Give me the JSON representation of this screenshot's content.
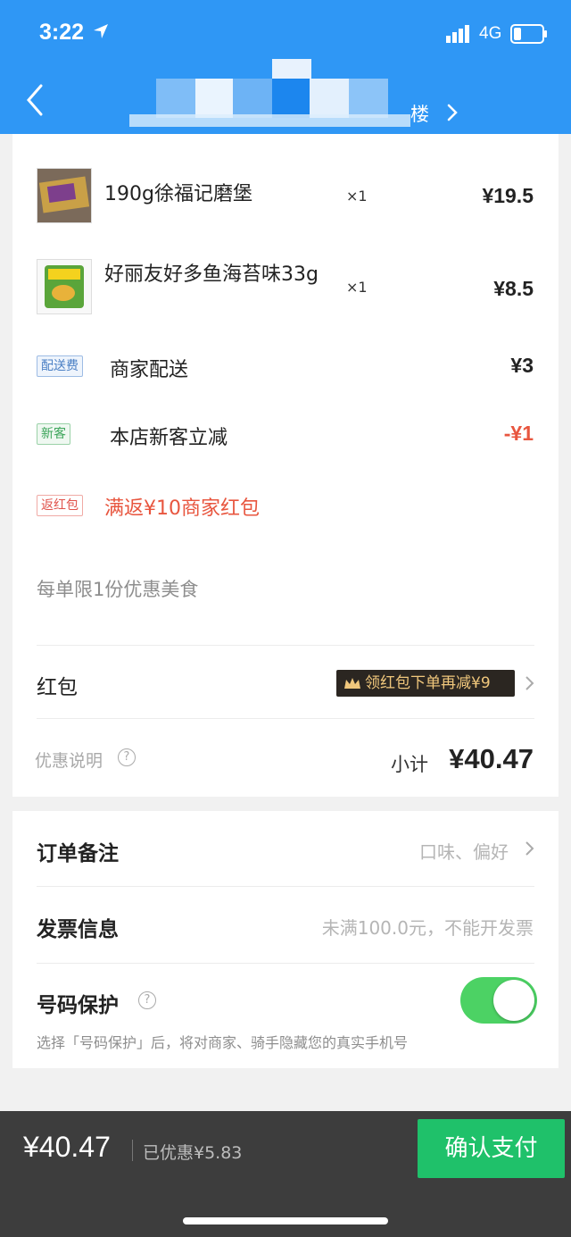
{
  "status_bar": {
    "time": "3:22",
    "network": "4G",
    "icons": [
      "location-arrow-icon",
      "signal-icon",
      "battery-icon"
    ]
  },
  "header": {
    "store_name_suffix": "楼",
    "icons": [
      "back-chevron-icon",
      "chevron-right-icon"
    ]
  },
  "order": {
    "items": [
      {
        "name": "190g徐福记磨堡",
        "qty": "×1",
        "price": "¥19.5"
      },
      {
        "name": "好丽友好多鱼海苔味33g",
        "qty": "×1",
        "price": "¥8.5"
      }
    ],
    "delivery": {
      "tag": "配送费",
      "label": "商家配送",
      "value": "¥3"
    },
    "new_customer": {
      "tag": "新客",
      "label": "本店新客立减",
      "value": "-¥1"
    },
    "cashback": {
      "tag": "返红包",
      "label": "满返¥10商家红包"
    },
    "limit_note": "每单限1份优惠美食",
    "red_packet": {
      "label": "红包",
      "chip": "领红包下单再减¥9"
    },
    "discount_info": "优惠说明",
    "subtotal_label": "小计",
    "subtotal_value": "¥40.47"
  },
  "extras": {
    "remark": {
      "label": "订单备注",
      "hint": "口味、偏好"
    },
    "invoice": {
      "label": "发票信息",
      "hint": "未满100.0元，不能开发票"
    },
    "privacy": {
      "label": "号码保护",
      "enabled": true,
      "description": "选择「号码保护」后，将对商家、骑手隐藏您的真实手机号"
    }
  },
  "footer": {
    "total": "¥40.47",
    "saved": "已优惠¥5.83",
    "pay_button": "确认支付"
  },
  "colors": {
    "header_blue": "#2f97f5",
    "pay_green": "#1fc16a",
    "toggle_green": "#4cd264",
    "discount_red": "#e8563f",
    "footer_dark": "#3d3d3d"
  }
}
